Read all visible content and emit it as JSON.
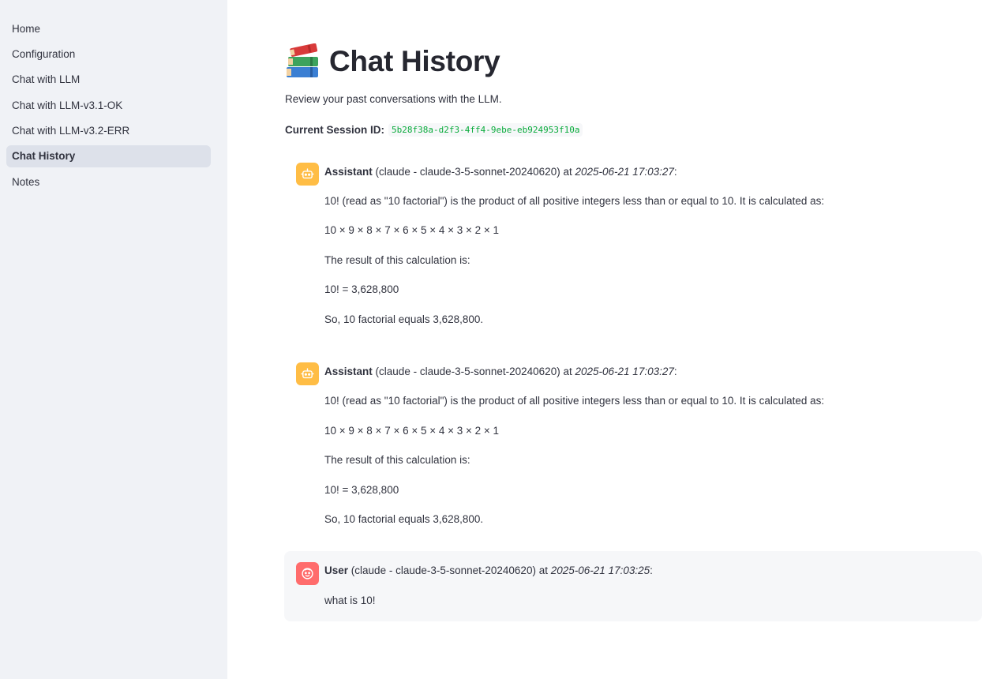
{
  "sidebar": {
    "items": [
      {
        "label": "Home"
      },
      {
        "label": "Configuration"
      },
      {
        "label": "Chat with LLM"
      },
      {
        "label": "Chat with LLM-v3.1-OK"
      },
      {
        "label": "Chat with LLM-v3.2-ERR"
      },
      {
        "label": "Chat History"
      },
      {
        "label": "Notes"
      }
    ],
    "active": "Chat History"
  },
  "page": {
    "title": "Chat History",
    "title_icon": "books-emoji",
    "subtitle": "Review your past conversations with the LLM.",
    "session_label": "Current Session ID:",
    "session_id": "5b28f38a-d2f3-4ff4-9ebe-eb924953f10a"
  },
  "messages": [
    {
      "role": "Assistant",
      "model": "(claude - claude-3-5-sonnet-20240620)",
      "at": "at",
      "timestamp": "2025-06-21 17:03:27",
      "colon": ":",
      "icon": "robot-icon",
      "lines": [
        "10! (read as \"10 factorial\") is the product of all positive integers less than or equal to 10. It is calculated as:",
        "10 × 9 × 8 × 7 × 6 × 5 × 4 × 3 × 2 × 1",
        "The result of this calculation is:",
        "10! = 3,628,800",
        "So, 10 factorial equals 3,628,800."
      ]
    },
    {
      "role": "Assistant",
      "model": "(claude - claude-3-5-sonnet-20240620)",
      "at": "at",
      "timestamp": "2025-06-21 17:03:27",
      "colon": ":",
      "icon": "robot-icon",
      "lines": [
        "10! (read as \"10 factorial\") is the product of all positive integers less than or equal to 10. It is calculated as:",
        "10 × 9 × 8 × 7 × 6 × 5 × 4 × 3 × 2 × 1",
        "The result of this calculation is:",
        "10! = 3,628,800",
        "So, 10 factorial equals 3,628,800."
      ]
    },
    {
      "role": "User",
      "model": "(claude - claude-3-5-sonnet-20240620)",
      "at": "at",
      "timestamp": "2025-06-21 17:03:25",
      "colon": ":",
      "icon": "face-icon",
      "lines": [
        "what is 10!"
      ]
    }
  ],
  "colors": {
    "sidebar_bg": "#f0f2f6",
    "active_item_bg": "#dde1ea",
    "assistant_avatar": "#ffbd45",
    "user_avatar": "#ff6c6c",
    "code_text": "#09ab3b",
    "user_message_bg": "#f6f7f9"
  }
}
